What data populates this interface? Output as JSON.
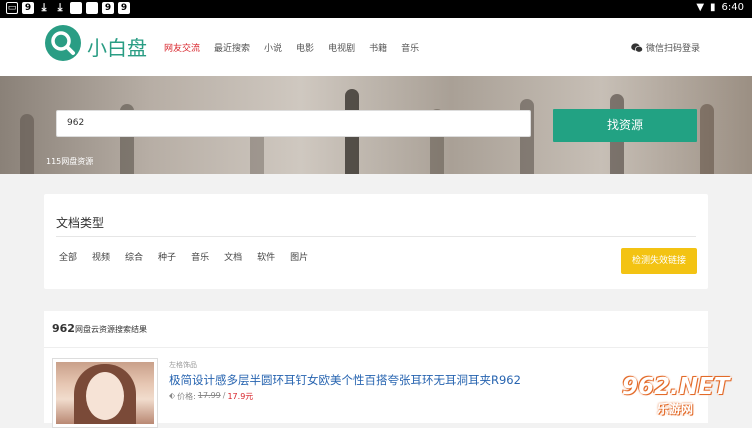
{
  "status_bar": {
    "time": "6:40"
  },
  "header": {
    "logo_text": "小白盘",
    "nav": [
      "网友交流",
      "最近搜索",
      "小说",
      "电影",
      "电视剧",
      "书籍",
      "音乐"
    ],
    "active_nav_index": 0,
    "login_label": "微信扫码登录"
  },
  "search": {
    "value": "962",
    "button_label": "找资源",
    "note": "115网盘资源"
  },
  "doc_types": {
    "title": "文档类型",
    "categories": [
      "全部",
      "视频",
      "综合",
      "种子",
      "音乐",
      "文档",
      "软件",
      "图片"
    ],
    "check_button_label": "检测失效链接"
  },
  "results": {
    "query": "962",
    "header_suffix": "网盘云资源搜索结果",
    "items": [
      {
        "shop": "左格饰品",
        "title": "极简设计感多层半圆环耳钉女欧美个性百搭夸张耳环无耳洞耳夹R962",
        "price_label": "价格:",
        "old_price": "17.99",
        "new_price": "17.9元"
      }
    ]
  },
  "watermark": {
    "main": "962.NET",
    "sub": "乐游网"
  },
  "colors": {
    "accent": "#22a283",
    "nav_active": "#d8232a",
    "check_button": "#f3c313",
    "link": "#2764b0"
  }
}
